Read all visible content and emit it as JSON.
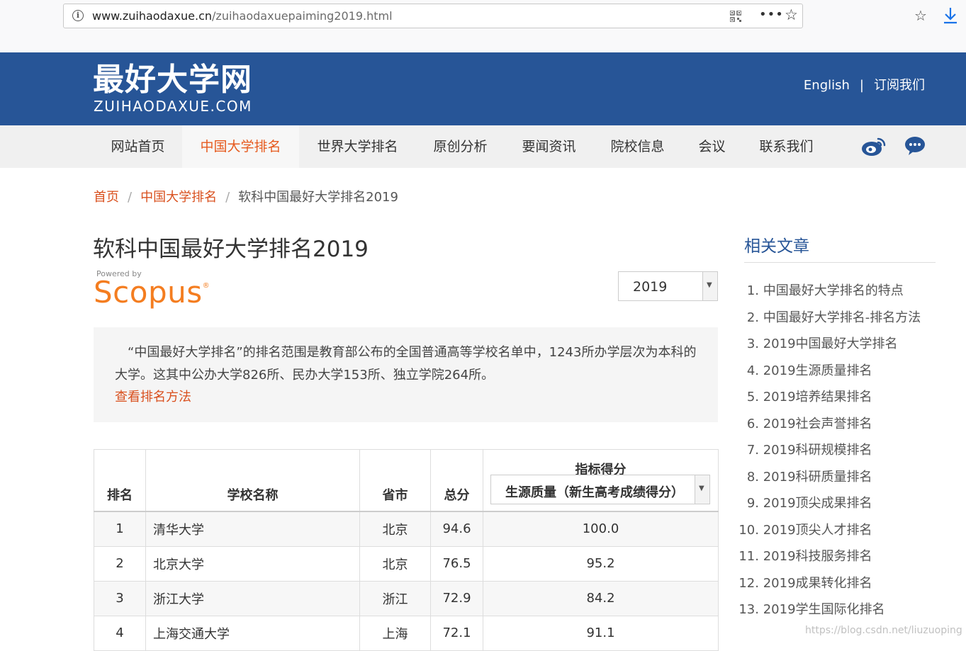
{
  "browser": {
    "url_host": "www.zuihaodaxue.cn",
    "url_path": "/zuihaodaxuepaiming2019.html"
  },
  "header": {
    "logo_cn": "最好大学网",
    "logo_en": "ZUIHAODAXUE.COM",
    "english": "English",
    "separator": "|",
    "subscribe": "订阅我们"
  },
  "nav": {
    "items": [
      "网站首页",
      "中国大学排名",
      "世界大学排名",
      "原创分析",
      "要闻资讯",
      "院校信息",
      "会议",
      "联系我们"
    ],
    "active_index": 1
  },
  "breadcrumb": {
    "home": "首页",
    "section": "中国大学排名",
    "current": "软科中国最好大学排名2019",
    "sep": "/"
  },
  "main": {
    "title": "软科中国最好大学排名2019",
    "powered_by": "Powered by",
    "scopus": "Scopus",
    "scopus_mark": "®",
    "year_selected": "2019",
    "intro": "“中国最好大学排名”的排名范围是教育部公布的全国普通高等学校名单中，1243所办学层次为本科的大学。这其中公办大学826所、民办大学153所、独立学院264所。",
    "method_link": "查看排名方法"
  },
  "table": {
    "headers": {
      "rank": "排名",
      "name": "学校名称",
      "province": "省市",
      "score": "总分",
      "indicator_title": "指标得分",
      "indicator_selected": "生源质量（新生高考成绩得分）"
    },
    "rows": [
      {
        "rank": "1",
        "name": "清华大学",
        "province": "北京",
        "score": "94.6",
        "indicator": "100.0"
      },
      {
        "rank": "2",
        "name": "北京大学",
        "province": "北京",
        "score": "76.5",
        "indicator": "95.2"
      },
      {
        "rank": "3",
        "name": "浙江大学",
        "province": "浙江",
        "score": "72.9",
        "indicator": "84.2"
      },
      {
        "rank": "4",
        "name": "上海交通大学",
        "province": "上海",
        "score": "72.1",
        "indicator": "91.1"
      }
    ]
  },
  "sidebar": {
    "title": "相关文章",
    "articles": [
      {
        "num": "1.",
        "title": "中国最好大学排名的特点"
      },
      {
        "num": "2.",
        "title": "中国最好大学排名-排名方法"
      },
      {
        "num": "3.",
        "title": "2019中国最好大学排名"
      },
      {
        "num": "4.",
        "title": "2019生源质量排名"
      },
      {
        "num": "5.",
        "title": "2019培养结果排名"
      },
      {
        "num": "6.",
        "title": "2019社会声誉排名"
      },
      {
        "num": "7.",
        "title": "2019科研规模排名"
      },
      {
        "num": "8.",
        "title": "2019科研质量排名"
      },
      {
        "num": "9.",
        "title": "2019顶尖成果排名"
      },
      {
        "num": "10.",
        "title": "2019顶尖人才排名"
      },
      {
        "num": "11.",
        "title": "2019科技服务排名"
      },
      {
        "num": "12.",
        "title": "2019成果转化排名"
      },
      {
        "num": "13.",
        "title": "2019学生国际化排名"
      }
    ]
  },
  "watermark": "https://blog.csdn.net/liuzuoping"
}
